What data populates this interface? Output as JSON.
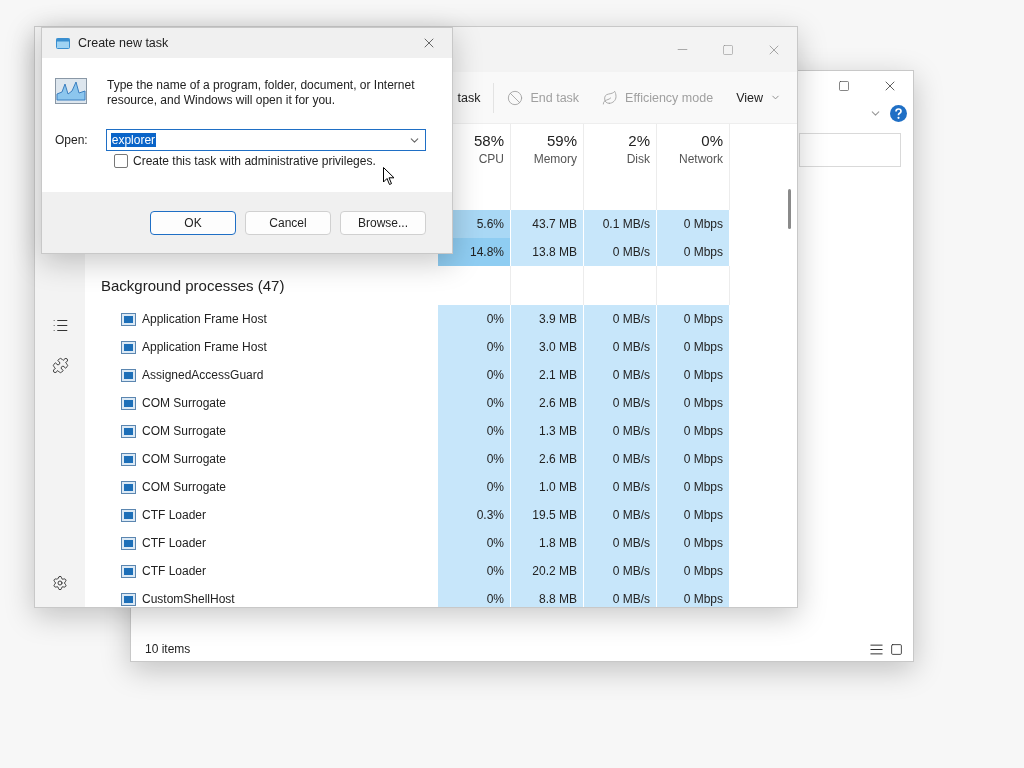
{
  "explorer": {
    "status": "10 items"
  },
  "task_manager": {
    "toolbar": [
      {
        "kind": "run",
        "label": "task",
        "disabled": false
      },
      {
        "kind": "end",
        "label": "End task",
        "disabled": true
      },
      {
        "kind": "efficiency",
        "label": "Efficiency mode",
        "disabled": true
      },
      {
        "kind": "view",
        "label": "View",
        "disabled": false
      }
    ],
    "nav": [
      {
        "kind": "details",
        "selected": false
      },
      {
        "kind": "services",
        "selected": false
      }
    ],
    "columns": [
      {
        "percent": "58%",
        "label": "CPU"
      },
      {
        "percent": "59%",
        "label": "Memory"
      },
      {
        "percent": "2%",
        "label": "Disk"
      },
      {
        "percent": "0%",
        "label": "Network"
      }
    ],
    "groups": [
      {
        "rows": [
          {
            "kind": "app",
            "cells": [
              "5.6%",
              "43.7 MB",
              "0.1 MB/s",
              "0 Mbps"
            ]
          },
          {
            "kind": "app",
            "cells": [
              "14.8%",
              "13.8 MB",
              "0 MB/s",
              "0 Mbps"
            ]
          }
        ]
      },
      {
        "title": "Background processes (47)",
        "rows": [
          {
            "kind": "process",
            "name": "Application Frame Host",
            "cells": [
              "0%",
              "3.9 MB",
              "0 MB/s",
              "0 Mbps"
            ]
          },
          {
            "kind": "process",
            "name": "Application Frame Host",
            "cells": [
              "0%",
              "3.0 MB",
              "0 MB/s",
              "0 Mbps"
            ]
          },
          {
            "kind": "process",
            "name": "AssignedAccessGuard",
            "cells": [
              "0%",
              "2.1 MB",
              "0 MB/s",
              "0 Mbps"
            ]
          },
          {
            "kind": "process",
            "name": "COM Surrogate",
            "cells": [
              "0%",
              "2.6 MB",
              "0 MB/s",
              "0 Mbps"
            ]
          },
          {
            "kind": "process",
            "name": "COM Surrogate",
            "cells": [
              "0%",
              "1.3 MB",
              "0 MB/s",
              "0 Mbps"
            ]
          },
          {
            "kind": "process",
            "name": "COM Surrogate",
            "cells": [
              "0%",
              "2.6 MB",
              "0 MB/s",
              "0 Mbps"
            ]
          },
          {
            "kind": "process",
            "name": "COM Surrogate",
            "cells": [
              "0%",
              "1.0 MB",
              "0 MB/s",
              "0 Mbps"
            ]
          },
          {
            "kind": "process",
            "name": "CTF Loader",
            "cells": [
              "0.3%",
              "19.5 MB",
              "0 MB/s",
              "0 Mbps"
            ]
          },
          {
            "kind": "process",
            "name": "CTF Loader",
            "cells": [
              "0%",
              "1.8 MB",
              "0 MB/s",
              "0 Mbps"
            ]
          },
          {
            "kind": "process",
            "name": "CTF Loader",
            "cells": [
              "0%",
              "20.2 MB",
              "0 MB/s",
              "0 Mbps"
            ]
          },
          {
            "kind": "process",
            "name": "CustomShellHost",
            "cells": [
              "0%",
              "8.8 MB",
              "0 MB/s",
              "0 Mbps"
            ]
          }
        ]
      }
    ]
  },
  "dialog": {
    "title": "Create new task",
    "message": "Type the name of a program, folder, document, or Internet resource, and Windows will open it for you.",
    "open_label": "Open:",
    "value": "explorer",
    "value_selected": true,
    "checkbox": {
      "label": "Create this task with administrative privileges.",
      "checked": false
    },
    "buttons": [
      {
        "label": "OK",
        "default": true
      },
      {
        "label": "Cancel",
        "default": false
      },
      {
        "label": "Browse...",
        "default": false
      }
    ]
  }
}
